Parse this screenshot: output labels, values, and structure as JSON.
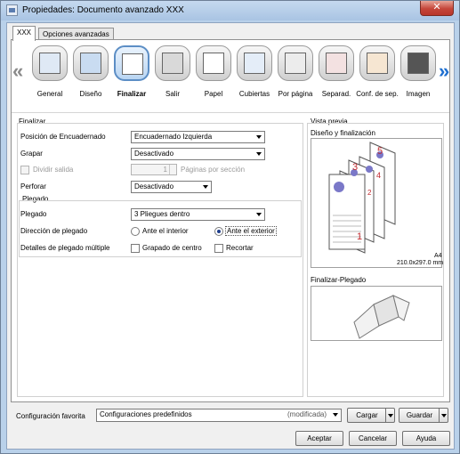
{
  "window": {
    "title": "Propiedades: Documento avanzado XXX",
    "close_glyph": "✕"
  },
  "tabs": [
    {
      "label": "XXX"
    },
    {
      "label": "Opciones avanzadas"
    }
  ],
  "toolbar": {
    "left_arrow": "«",
    "right_arrow": "»",
    "items": [
      {
        "label": "General",
        "icon": "printer-icon"
      },
      {
        "label": "Diseño",
        "icon": "layout-icon"
      },
      {
        "label": "Finalizar",
        "icon": "finishing-icon",
        "selected": true
      },
      {
        "label": "Salir",
        "icon": "output-icon"
      },
      {
        "label": "Papel",
        "icon": "paper-icon"
      },
      {
        "label": "Cubiertas",
        "icon": "covers-icon"
      },
      {
        "label": "Por página",
        "icon": "per-page-icon"
      },
      {
        "label": "Separad.",
        "icon": "separators-icon"
      },
      {
        "label": "Conf. de sep.",
        "icon": "separator-settings-icon"
      },
      {
        "label": "Imagen",
        "icon": "image-icon"
      }
    ]
  },
  "finalizar": {
    "group_title": "Finalizar",
    "binding_position_label": "Posición de Encuadernado",
    "binding_position_value": "Encuadernado Izquierda",
    "staple_label": "Grapar",
    "staple_value": "Desactivado",
    "split_output_label": "Dividir salida",
    "pages_value": "1",
    "pages_per_section_label": "Páginas por sección",
    "punch_label": "Perforar",
    "punch_value": "Desactivado"
  },
  "plegado": {
    "group_title": "Plegado",
    "fold_label": "Plegado",
    "fold_value": "3 Pliegues dentro",
    "direction_label": "Dirección de plegado",
    "inside_label": "Ante el interior",
    "outside_label": "Ante el exterior",
    "multi_fold_label": "Detalles de plegado múltiple",
    "center_staple_label": "Grapado de centro",
    "trim_label": "Recortar"
  },
  "preview": {
    "group_title": "Vista previa",
    "layout_title": "Diseño y finalización",
    "page_numbers": [
      "5",
      "4",
      "3",
      "2",
      "1"
    ],
    "paper_size": "A4",
    "paper_dims": "210.0x297.0 mm",
    "fold_title": "Finalizar-Plegado"
  },
  "favorites": {
    "label": "Configuración favorita",
    "value": "Configuraciones predefinidos",
    "modified": "(modificada)",
    "load_label": "Cargar",
    "save_label": "Guardar"
  },
  "buttons": {
    "ok": "Aceptar",
    "cancel": "Cancelar",
    "help": "Ayuda"
  }
}
